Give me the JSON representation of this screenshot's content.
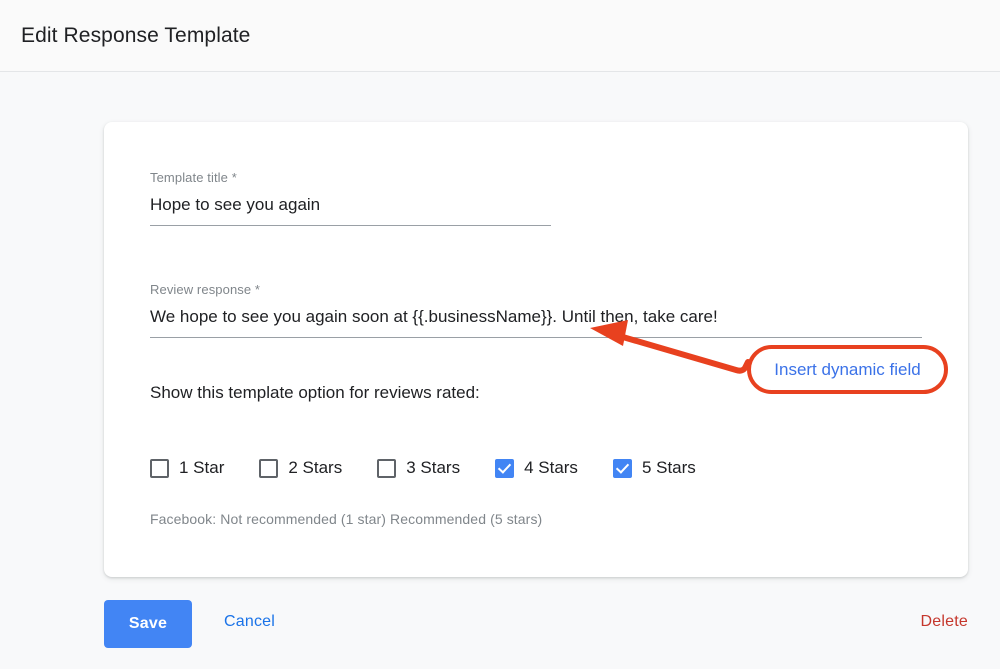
{
  "header": {
    "title": "Edit Response Template"
  },
  "form": {
    "title_field": {
      "label": "Template title *",
      "value": "Hope to see you again",
      "placeholder": "Template title"
    },
    "response_field": {
      "label": "Review response *",
      "value": "We hope to see you again soon at {{.businessName}}. Until then, take care!",
      "placeholder": "Review response"
    },
    "rating_section_label": "Show this template option for reviews rated:",
    "rating_options": [
      {
        "label": "1 Star",
        "checked": false
      },
      {
        "label": "2 Stars",
        "checked": false
      },
      {
        "label": "3 Stars",
        "checked": false
      },
      {
        "label": "4 Stars",
        "checked": true
      },
      {
        "label": "5 Stars",
        "checked": true
      }
    ],
    "helper_text": "Facebook: Not recommended (1 star) Recommended (5 stars)"
  },
  "actions": {
    "save_label": "Save",
    "cancel_label": "Cancel",
    "delete_label": "Delete"
  },
  "annotation": {
    "callout_text": "Insert dynamic field",
    "callout_border_color": "#e8411f",
    "callout_text_color": "#3b72e8",
    "arrow_color": "#e8411f"
  },
  "colors": {
    "accent_blue": "#4285f4",
    "link_blue": "#1a73e8",
    "danger_red": "#c5372c",
    "page_background": "#f8f9fa",
    "card_background": "#ffffff",
    "label_gray": "#80868b"
  }
}
